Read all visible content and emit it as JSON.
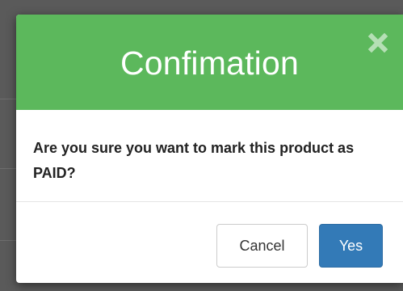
{
  "modal": {
    "title": "Confimation",
    "message": "Are you sure you want to mark this product as PAID?",
    "close_icon": "close-icon",
    "buttons": {
      "cancel_label": "Cancel",
      "yes_label": "Yes"
    }
  },
  "colors": {
    "header_bg": "#5cb85c",
    "primary_button": "#337ab7",
    "overlay": "#5a5a5a"
  }
}
